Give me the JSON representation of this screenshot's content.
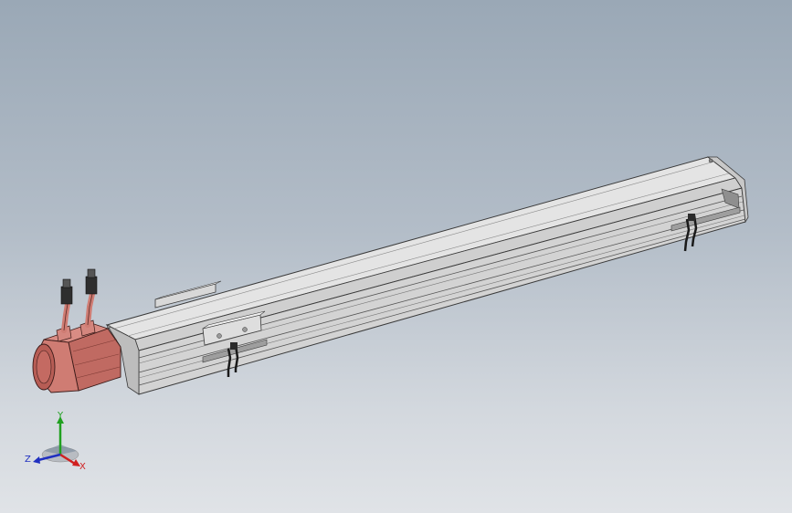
{
  "viewport": {
    "background_top": "#9aa8b6",
    "background_bottom": "#e0e3e7"
  },
  "model": {
    "body_color": "#dcdcdc",
    "edge_color": "#3a3a3a",
    "motor_color": "#c8766e"
  },
  "triad": {
    "x_label": "X",
    "y_label": "Y",
    "z_label": "Z",
    "x_color": "#d02020",
    "y_color": "#20a020",
    "z_color": "#2030c0"
  }
}
